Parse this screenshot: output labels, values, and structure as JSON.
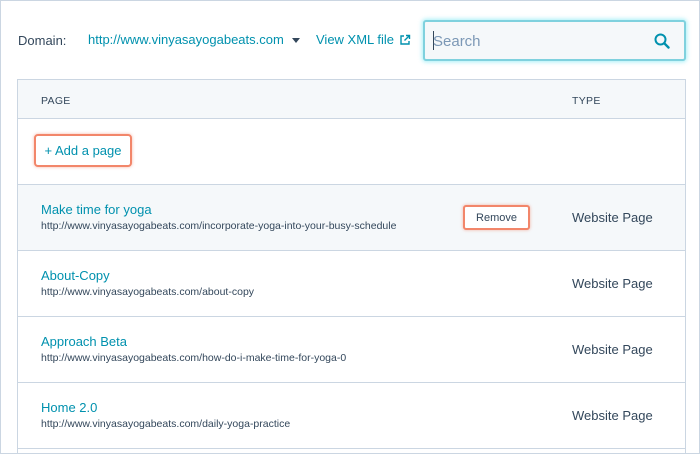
{
  "header": {
    "domain_label": "Domain:",
    "domain_value": "http://www.vinyasayogabeats.com",
    "xml_link_label": "View XML file",
    "search": {
      "placeholder": "Search",
      "value": ""
    }
  },
  "table": {
    "columns": {
      "page": "PAGE",
      "type": "TYPE"
    },
    "add_button_label": "+ Add a page",
    "remove_button_label": "Remove",
    "rows": [
      {
        "title": "Make time for yoga",
        "url": "http://www.vinyasayogabeats.com/incorporate-yoga-into-your-busy-schedule",
        "type": "Website Page"
      },
      {
        "title": "About-Copy",
        "url": "http://www.vinyasayogabeats.com/about-copy",
        "type": "Website Page"
      },
      {
        "title": "Approach Beta",
        "url": "http://www.vinyasayogabeats.com/how-do-i-make-time-for-yoga-0",
        "type": "Website Page"
      },
      {
        "title": "Home 2.0",
        "url": "http://www.vinyasayogabeats.com/daily-yoga-practice",
        "type": "Website Page"
      }
    ]
  },
  "colors": {
    "link": "#0091ae",
    "text": "#33475b",
    "highlight": "#f2866a",
    "focus": "#7fd1de"
  },
  "icons": {
    "domain_caret": "chevron-down-icon",
    "external": "external-link-icon",
    "search": "search-icon"
  }
}
